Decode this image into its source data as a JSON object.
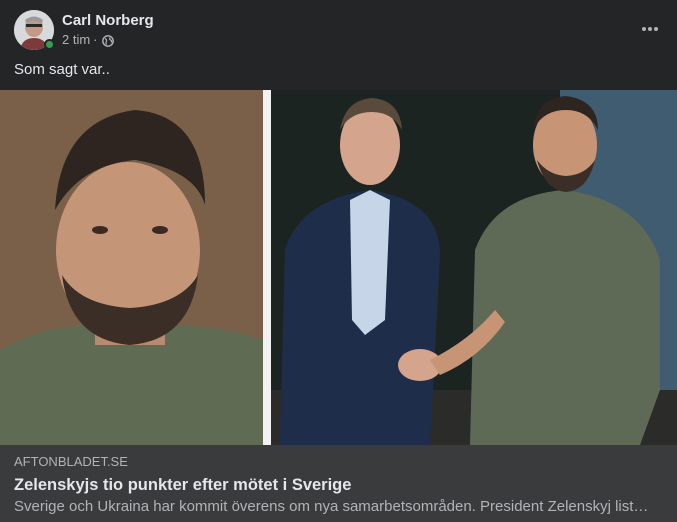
{
  "post": {
    "author": "Carl Norberg",
    "timestamp": "2 tim",
    "separator": "·",
    "audience_icon": "globe-icon",
    "more_icon": "more-horizontal-icon",
    "caption": "Som sagt var.."
  },
  "link_preview": {
    "domain": "AFTONBLADET.SE",
    "title": "Zelenskyjs tio punkter efter mötet i Sverige",
    "description": "Sverige och Ukraina har kommit överens om nya samarbetsområden. President Zelenskyj list…"
  },
  "colors": {
    "background": "#242526",
    "link_box": "#3a3b3c",
    "primary_text": "#e4e6eb",
    "secondary_text": "#b0b3b8",
    "online": "#31a24c"
  }
}
